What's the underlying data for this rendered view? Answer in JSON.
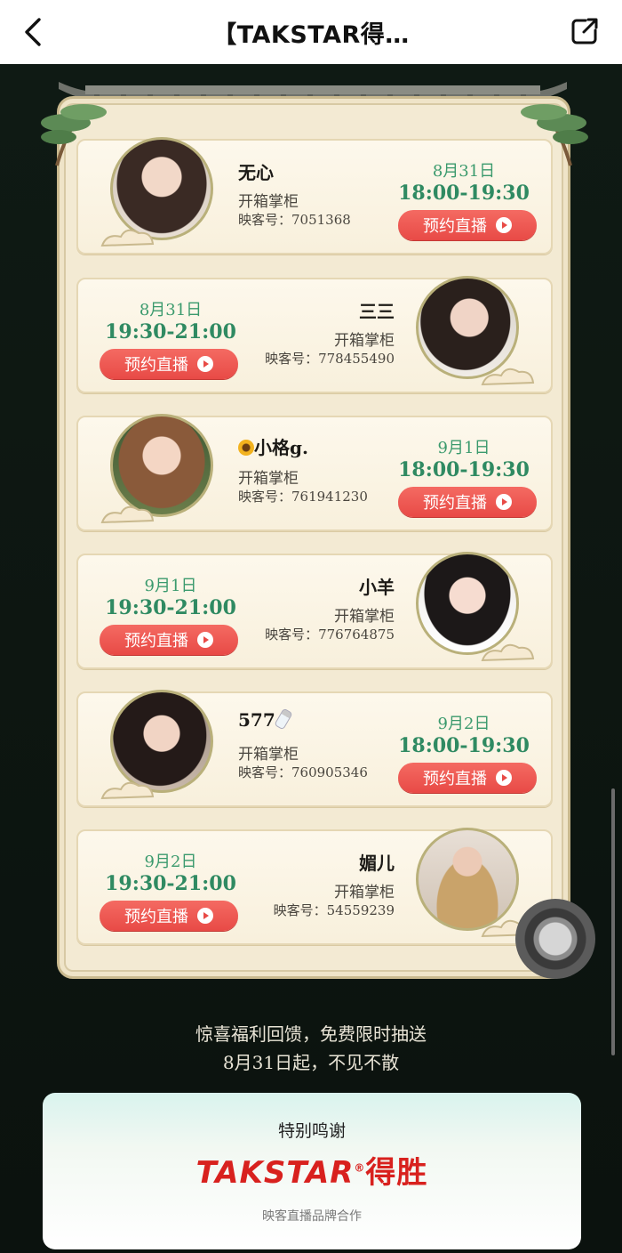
{
  "nav": {
    "title": "【TAKSTAR得…"
  },
  "role_label": "开箱掌柜",
  "reserve_label": "预约直播",
  "uid_prefix": "映客号：",
  "hosts": [
    {
      "name": "无心",
      "uid": "映客号：7051368",
      "date": "8月31日",
      "time": "18:00-19:30"
    },
    {
      "name": "三三",
      "uid": "映客号：778455490",
      "date": "8月31日",
      "time": "19:30-21:00"
    },
    {
      "name": "小格g.",
      "uid": "映客号：761941230",
      "date": "9月1日",
      "time": "18:00-19:30",
      "name_icon": "sunflower-icon"
    },
    {
      "name": "小羊",
      "uid": "映客号：776764875",
      "date": "9月1日",
      "time": "19:30-21:00"
    },
    {
      "name": "577",
      "uid": "映客号：760905346",
      "date": "9月2日",
      "time": "18:00-19:30",
      "name_icon": "baby-bottle-icon"
    },
    {
      "name": "媚儿",
      "uid": "映客号：54559239",
      "date": "9月2日",
      "time": "19:30-21:00"
    }
  ],
  "promo": {
    "line1": "惊喜福利回馈，免费限时抽送",
    "line2": "8月31日起，不见不散"
  },
  "thanks": {
    "title": "特别鸣谢",
    "brand_latin": "TAKSTAR",
    "brand_cn": "得胜",
    "subtitle": "映客直播品牌合作"
  },
  "colors": {
    "accent_green": "#3b9a6d",
    "button_red": "#e84a46",
    "brand_red": "#d8211e",
    "panel_bg": "#f3ead3"
  }
}
